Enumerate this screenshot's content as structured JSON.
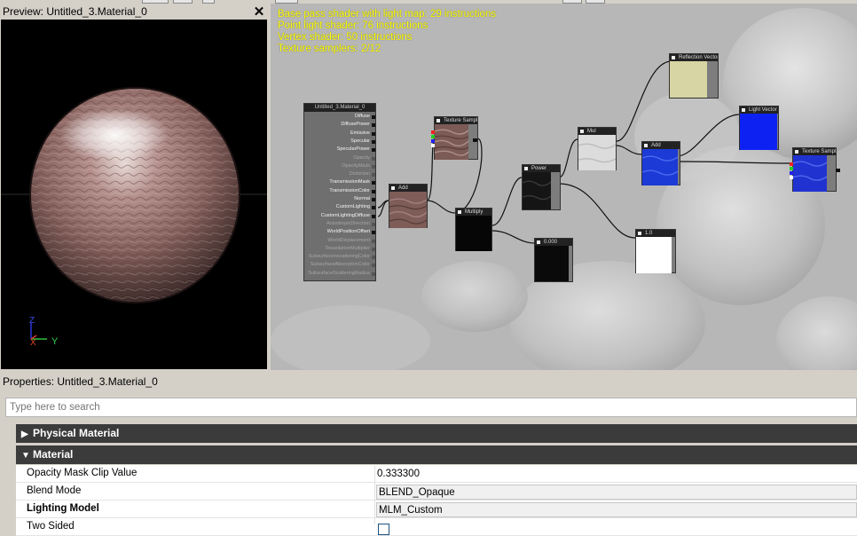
{
  "preview": {
    "title": "Preview: Untitled_3.Material_0",
    "close_glyph": "✕",
    "gizmo": {
      "z_label": "Z",
      "x_label": "X",
      "y_label": "Y"
    }
  },
  "graph": {
    "stats": [
      "Base pass shader with light map: 29 instructions",
      "Point light shader: 76 instructions",
      "Vertex shader: 50 instructions",
      "Texture samplers: 2/12"
    ],
    "material_node": {
      "title": "Untitled_3.Material_0",
      "pins": [
        {
          "label": "Diffuse",
          "active": true
        },
        {
          "label": "DiffusePower",
          "active": true
        },
        {
          "label": "Emissive",
          "active": true
        },
        {
          "label": "Specular",
          "active": true
        },
        {
          "label": "SpecularPower",
          "active": true
        },
        {
          "label": "Opacity",
          "active": false
        },
        {
          "label": "OpacityMask",
          "active": false
        },
        {
          "label": "Distortion",
          "active": false
        },
        {
          "label": "TransmissionMask",
          "active": true
        },
        {
          "label": "TransmissionColor",
          "active": true
        },
        {
          "label": "Normal",
          "active": true
        },
        {
          "label": "CustomLighting",
          "active": true
        },
        {
          "label": "CustomLightingDiffuse",
          "active": true
        },
        {
          "label": "AnisotropicDirection",
          "active": false
        },
        {
          "label": "WorldPositionOffset",
          "active": true
        },
        {
          "label": "WorldDisplacement",
          "active": false
        },
        {
          "label": "TessellationMultiplier",
          "active": false
        },
        {
          "label": "SubsurfaceInscatteringColor",
          "active": false
        },
        {
          "label": "SubsurfaceAbsorptionColor",
          "active": false
        },
        {
          "label": "SubsurfaceScatteringRadius",
          "active": false
        }
      ]
    },
    "nodes": {
      "texture_sample": "Texture Sample",
      "add1": "Add",
      "multiply": "Multiply",
      "power": "Power",
      "mul2": "Mul",
      "add2": "Add",
      "reflection_vector": "Reflection Vector",
      "light_vector": "Light Vector",
      "normal_sample": "Texture Sample",
      "constant": "0.000",
      "one": "1.0"
    }
  },
  "properties": {
    "title": "Properties: Untitled_3.Material_0",
    "search_placeholder": "Type here to search",
    "categories": {
      "physical": "Physical Material",
      "material": "Material"
    },
    "rows": [
      {
        "label": "Opacity Mask Clip Value",
        "value": "0.333300"
      },
      {
        "label": "Blend Mode",
        "value": "BLEND_Opaque"
      },
      {
        "label": "Lighting Model",
        "value": "MLM_Custom"
      },
      {
        "label": "Two Sided",
        "value": ""
      }
    ]
  }
}
